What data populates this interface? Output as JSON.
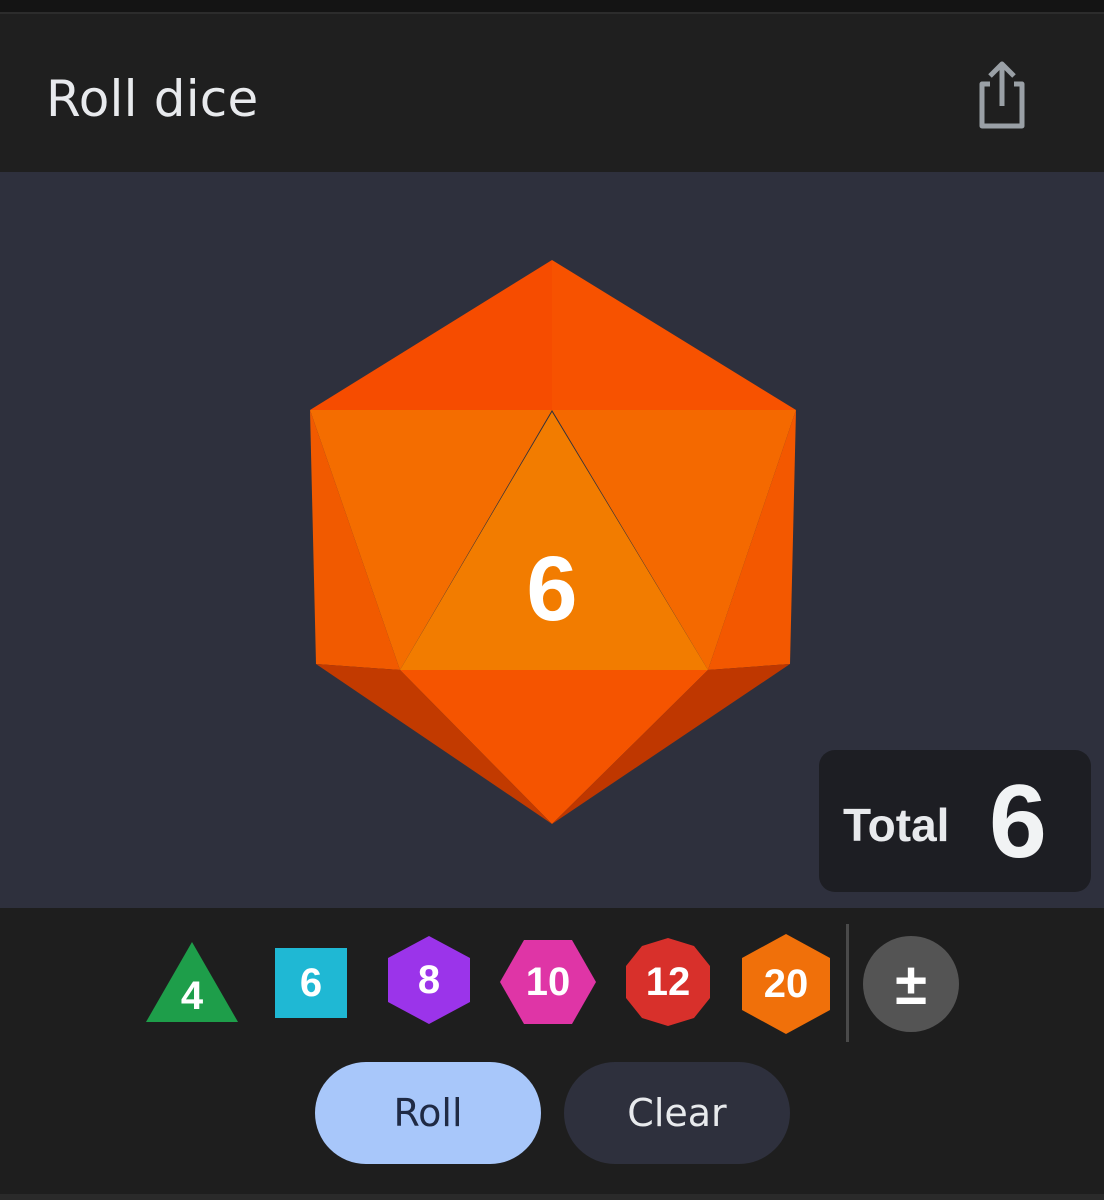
{
  "header": {
    "title": "Roll dice",
    "share_icon": "share-icon"
  },
  "result": {
    "die_value": "6",
    "total_label": "Total",
    "total_value": "6"
  },
  "dice": [
    {
      "label": "4",
      "shape": "triangle",
      "color": "#1e9e4a"
    },
    {
      "label": "6",
      "shape": "square",
      "color": "#1fb8d4"
    },
    {
      "label": "8",
      "shape": "hexagon",
      "color": "#9b34ea"
    },
    {
      "label": "10",
      "shape": "hexagon-flat",
      "color": "#df35a6"
    },
    {
      "label": "12",
      "shape": "decagon",
      "color": "#d8302b"
    },
    {
      "label": "20",
      "shape": "hexagon",
      "color": "#f0700a"
    }
  ],
  "modifier": {
    "label": "±"
  },
  "actions": {
    "roll_label": "Roll",
    "clear_label": "Clear"
  },
  "colors": {
    "accent_die": "#f75200",
    "roll_button": "#a8c7fa",
    "stage_background": "#2e303d"
  }
}
